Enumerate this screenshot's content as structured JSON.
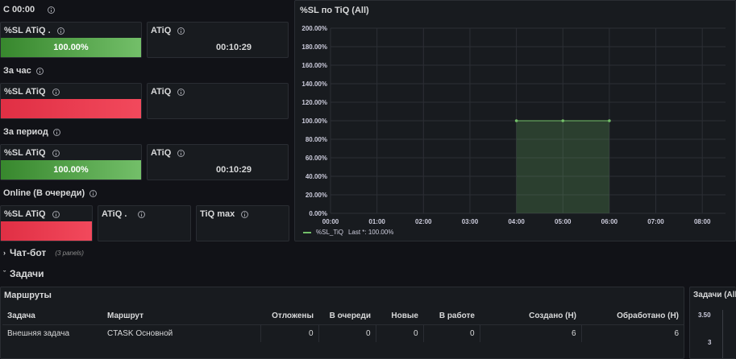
{
  "rows": {
    "since_midnight": "С 00:00",
    "per_hour": "За час",
    "per_period": "За период",
    "online": "Online (В очереди)"
  },
  "panels": {
    "sl1": {
      "title": "%SL ATiQ .",
      "value": "100.00%"
    },
    "atiq1": {
      "title": "ATiQ",
      "value": "00:10:29"
    },
    "sl2": {
      "title": "%SL ATiQ"
    },
    "atiq2": {
      "title": "ATiQ"
    },
    "sl3": {
      "title": "%SL ATiQ",
      "value": "100.00%"
    },
    "atiq3": {
      "title": "ATiQ",
      "value": "00:10:29"
    },
    "sl4": {
      "title": "%SL ATiQ"
    },
    "atiq4": {
      "title": "ATiQ ."
    },
    "tiqmax": {
      "title": "TiQ max"
    }
  },
  "chart_data": {
    "type": "area",
    "title": "%SL по TiQ (All)",
    "x_ticks": [
      "00:00",
      "01:00",
      "02:00",
      "03:00",
      "04:00",
      "05:00",
      "06:00",
      "07:00",
      "08:00"
    ],
    "y_ticks": [
      "0.00%",
      "20.00%",
      "40.00%",
      "60.00%",
      "80.00%",
      "100.00%",
      "120.00%",
      "140.00%",
      "160.00%",
      "180.00%",
      "200.00%"
    ],
    "ylim": [
      0,
      200
    ],
    "xlim": [
      "00:00",
      "08:30"
    ],
    "series": [
      {
        "name": "%SL_TiQ",
        "x": [
          "04:00",
          "05:00",
          "06:00"
        ],
        "values": [
          100,
          100,
          100
        ],
        "color": "#73bf69"
      }
    ],
    "legend": {
      "label": "%SL_TiQ",
      "stat": "Last *: 100.00%",
      "placement": "bottom-left"
    },
    "grid": true
  },
  "sections": {
    "chatbot": {
      "title": "Чат-бот",
      "meta": "(3 panels)"
    },
    "tasks": {
      "title": "Задачи"
    }
  },
  "routes": {
    "title": "Маршруты",
    "columns": [
      "Задача",
      "Маршрут",
      "Отложены",
      "В очереди",
      "Новые",
      "В работе",
      "Создано (Н)",
      "Обработано (Н)"
    ],
    "rows": [
      [
        "Внешняя задача",
        "CTASK Основной",
        "0",
        "0",
        "0",
        "0",
        "6",
        "6"
      ]
    ]
  },
  "tasks_panel": {
    "title": "Задачи (All",
    "y_ticks": [
      "3.50",
      "3"
    ]
  },
  "colors": {
    "background": "#111217",
    "panel": "#181b1f",
    "green": "#73bf69",
    "red": "#f2495c"
  }
}
